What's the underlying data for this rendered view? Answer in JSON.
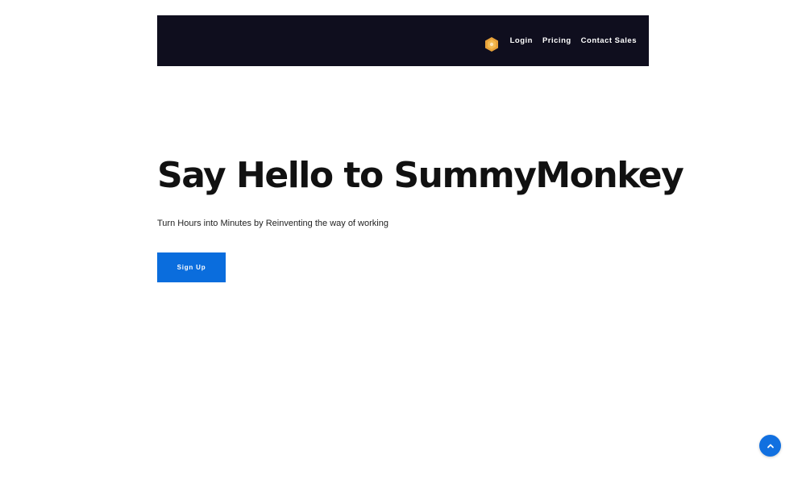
{
  "nav": {
    "brand_icon": "hexagon-logo-icon",
    "links": [
      "Login",
      "Pricing",
      "Contact Sales"
    ]
  },
  "hero": {
    "title": "Say Hello to SummyMonkey",
    "subtitle": "Turn Hours into Minutes by Reinventing the way of working",
    "cta_label": "Sign Up"
  },
  "scroll_top": {
    "icon": "chevron-up-icon"
  },
  "colors": {
    "navbar_bg": "#0f0e1e",
    "accent": "#0a6ddd",
    "logo": "#e8a23a"
  }
}
